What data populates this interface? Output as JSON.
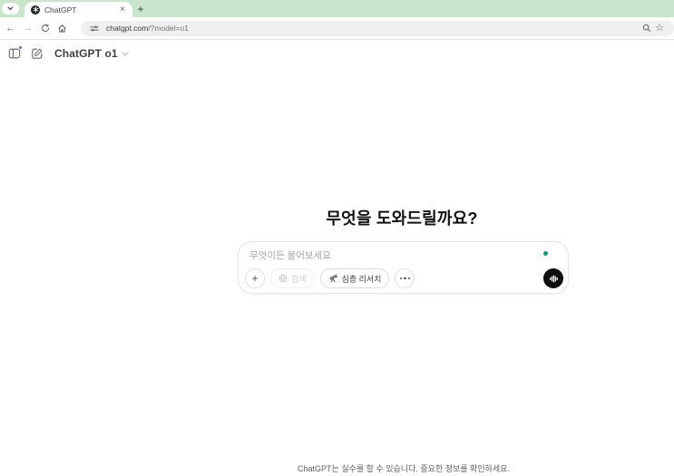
{
  "colors": {
    "tabstrip_green": "#c8e6cc",
    "omnibox_gray": "#efefef",
    "accent_teal": "#0d9488",
    "notification_blue": "#2e72f6",
    "voice_button_black": "#0d0d0d"
  },
  "browser": {
    "tab_title": "ChatGPT",
    "url_domain": "chatgpt.com",
    "url_path": "/?model=o1"
  },
  "icons": {
    "back_glyph": "←",
    "forward_glyph": "→",
    "star_glyph": "☆",
    "new_tab_glyph": "+",
    "tab_close_glyph": "×",
    "attach_glyph": "+"
  },
  "page": {
    "model_switcher_label": "ChatGPT o1",
    "greeting": "무엇을 도와드릴까요?",
    "composer": {
      "placeholder": "무엇이든 물어보세요",
      "search_label": "검색",
      "deep_research_label": "심층 리서치"
    },
    "disclaimer": "ChatGPT는 실수를 할 수 있습니다. 중요한 정보를 확인하세요."
  }
}
